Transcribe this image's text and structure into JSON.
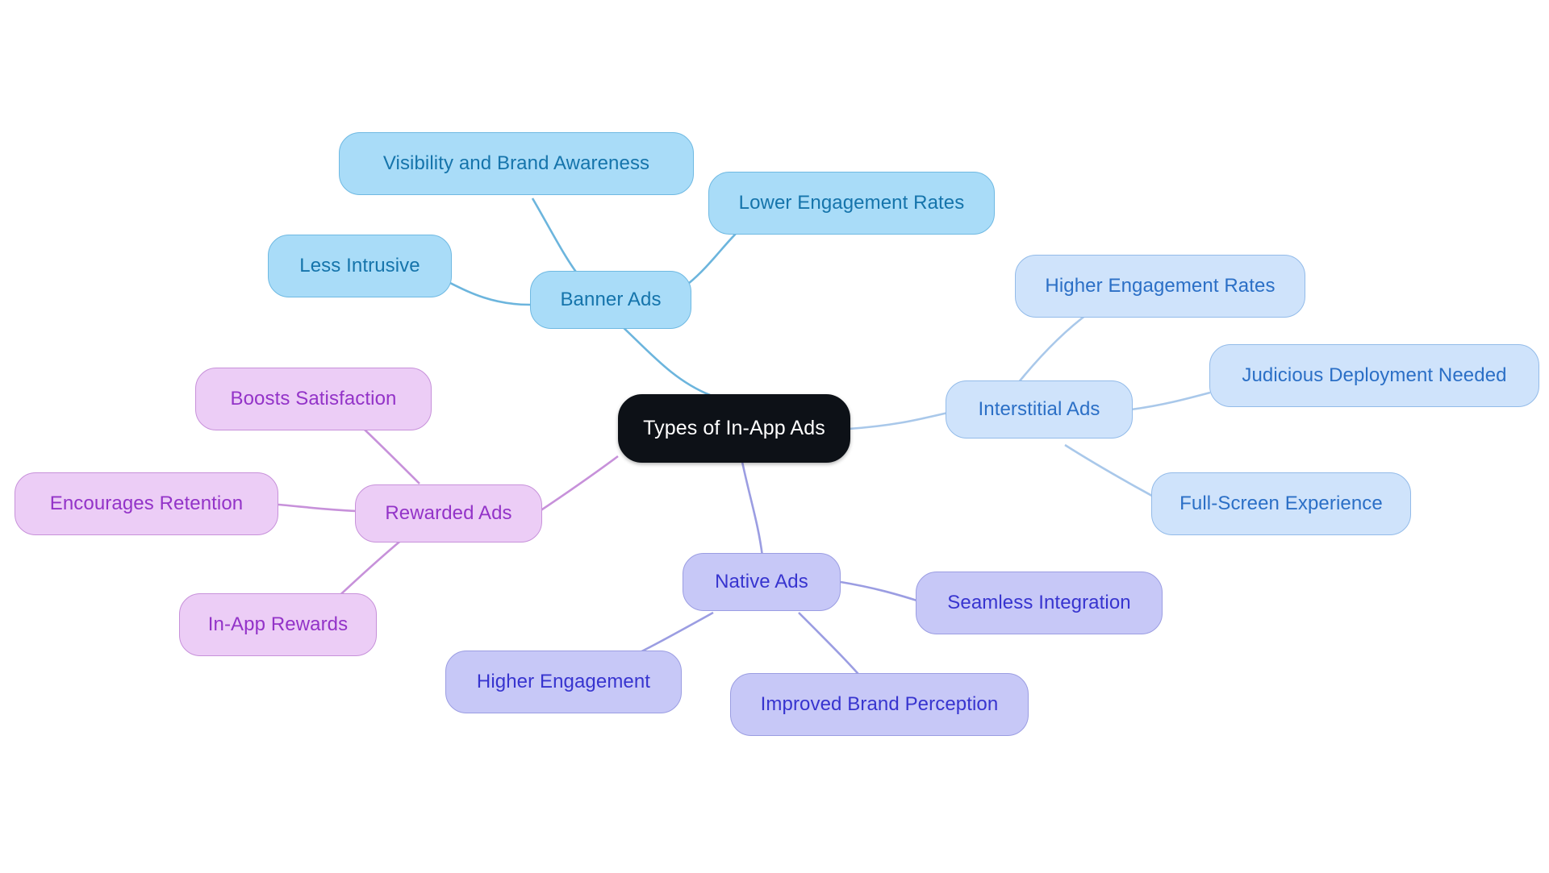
{
  "diagram": {
    "type": "mindmap",
    "title": "Types of In-App Ads",
    "background_color": "#ffffff",
    "root": {
      "label": "Types of In-App Ads",
      "fill": "#0d1117",
      "text_color": "#ffffff"
    },
    "branches": [
      {
        "id": "banner",
        "label": "Banner Ads",
        "fill": "#a9dcf8",
        "stroke": "#6fb9e2",
        "text_color": "#1574ab",
        "children": [
          {
            "label": "Visibility and Brand Awareness"
          },
          {
            "label": "Less Intrusive"
          },
          {
            "label": "Lower Engagement Rates"
          }
        ]
      },
      {
        "id": "interstitial",
        "label": "Interstitial Ads",
        "fill": "#cfe3fb",
        "stroke": "#93bbe9",
        "text_color": "#2b6fc6",
        "children": [
          {
            "label": "Higher Engagement Rates"
          },
          {
            "label": "Judicious Deployment Needed"
          },
          {
            "label": "Full-Screen Experience"
          }
        ]
      },
      {
        "id": "native",
        "label": "Native Ads",
        "fill": "#c7c8f7",
        "stroke": "#9b9de2",
        "text_color": "#3734cf",
        "children": [
          {
            "label": "Seamless Integration"
          },
          {
            "label": "Improved Brand Perception"
          },
          {
            "label": "Higher Engagement"
          }
        ]
      },
      {
        "id": "rewarded",
        "label": "Rewarded Ads",
        "fill": "#eccdf6",
        "stroke": "#c791da",
        "text_color": "#9333c8",
        "children": [
          {
            "label": "Boosts Satisfaction"
          },
          {
            "label": "Encourages Retention"
          },
          {
            "label": "In-App Rewards"
          }
        ]
      }
    ]
  },
  "nodes": {
    "root": "Types of In-App Ads",
    "banner": "Banner Ads",
    "banner_visibility": "Visibility and Brand Awareness",
    "banner_less_intrusive": "Less Intrusive",
    "banner_lower_engagement": "Lower Engagement Rates",
    "interstitial": "Interstitial Ads",
    "interstitial_higher_engagement": "Higher Engagement Rates",
    "interstitial_judicious": "Judicious Deployment Needed",
    "interstitial_fullscreen": "Full-Screen Experience",
    "native": "Native Ads",
    "native_seamless": "Seamless Integration",
    "native_brand_perception": "Improved Brand Perception",
    "native_higher_engagement": "Higher Engagement",
    "rewarded": "Rewarded Ads",
    "rewarded_boosts": "Boosts Satisfaction",
    "rewarded_retention": "Encourages Retention",
    "rewarded_inapp": "In-App Rewards"
  }
}
